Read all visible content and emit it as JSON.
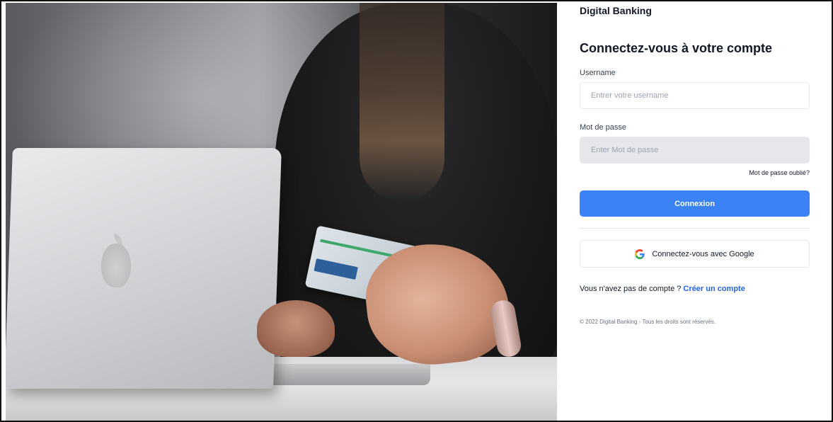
{
  "app": {
    "brand": "Digital Banking"
  },
  "login": {
    "title": "Connectez-vous à votre compte",
    "username_label": "Username",
    "username_placeholder": "Entrer votre username",
    "username_value": "",
    "password_label": "Mot de passe",
    "password_placeholder": "Enter Mot de passe",
    "password_value": "",
    "forgot_password": "Mot de passe oublié?",
    "submit_label": "Connexion",
    "google_label": "Connectez-vous avec Google",
    "google_icon": "google-g-icon",
    "no_account_text": "Vous n'avez pas de compte ? ",
    "create_account_link": "Créer un compte"
  },
  "footer": {
    "copyright": "© 2022 Digital Banking - Tous les droits sont réservés."
  },
  "colors": {
    "primary": "#3b82f6",
    "link": "#2563eb",
    "input_disabled_bg": "#e5e7eb",
    "text": "#111827"
  }
}
